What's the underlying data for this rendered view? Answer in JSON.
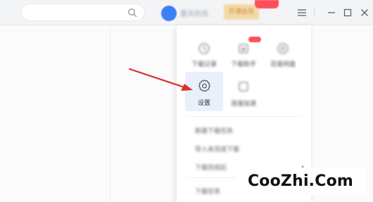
{
  "topbar": {
    "search": {
      "placeholder": ""
    },
    "username": "夏天的风",
    "vip_label": "开通会员",
    "window_controls": [
      "menu-icon",
      "minimize-icon",
      "maximize-icon",
      "close-icon"
    ]
  },
  "menu": {
    "tiles": [
      {
        "label": "下载记录",
        "icon": "download-history-icon"
      },
      {
        "label": "下载助手",
        "icon": "download-helper-icon"
      },
      {
        "label": "百度网盘",
        "icon": "cloud-disk-icon"
      },
      {
        "label": "设置",
        "icon": "gear-icon"
      },
      {
        "label": "连接加速",
        "icon": "speed-up-icon"
      }
    ],
    "items": [
      {
        "label": "新建下载任务"
      },
      {
        "label": "导入未完成下载"
      },
      {
        "label": "下载完成后"
      },
      {
        "label": "下载任务"
      }
    ]
  },
  "annotation": {
    "arrow_color": "#d9312b"
  },
  "watermark": {
    "text": "CooZhi.Com"
  },
  "colors": {
    "accent": "#3a7ff6",
    "active_tile": "#e9f0fb",
    "vip_gold": "#f5d9a6",
    "badge_red": "#ff4d5a"
  }
}
